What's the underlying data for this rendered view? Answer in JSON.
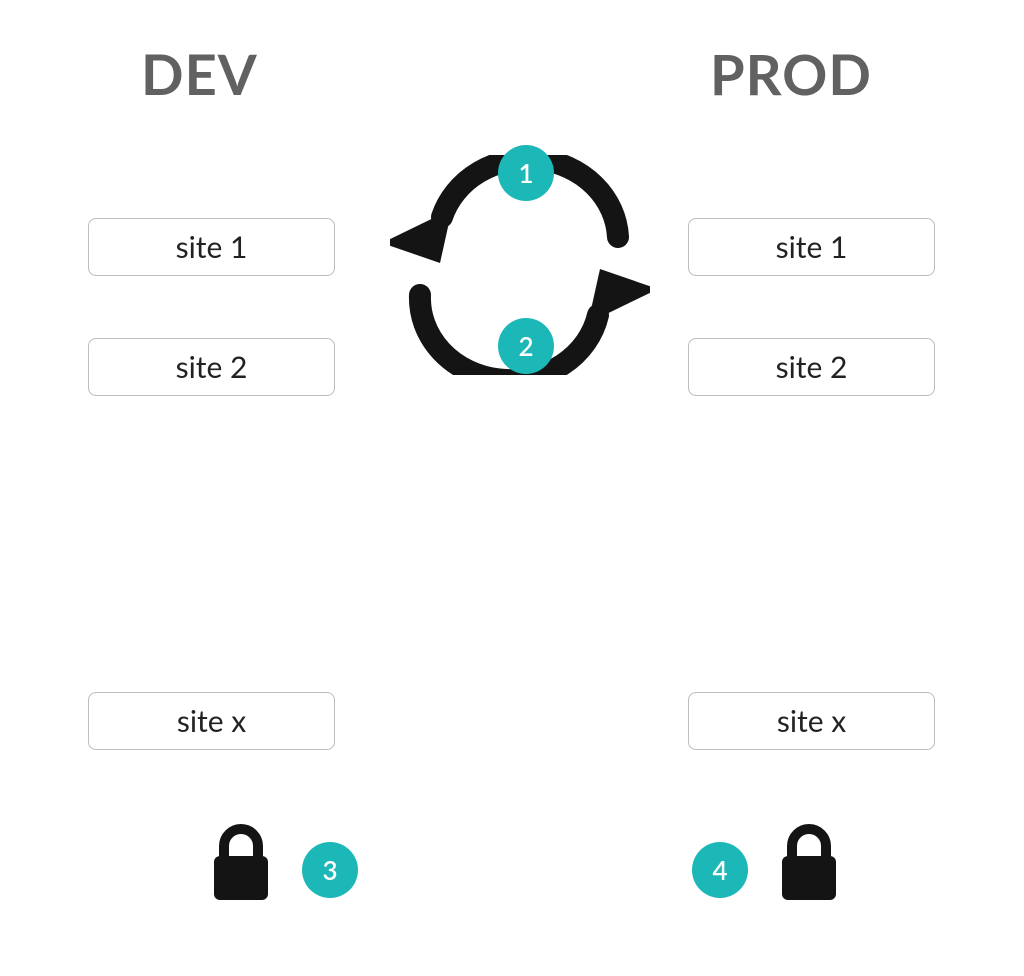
{
  "headings": {
    "dev": "DEV",
    "prod": "PROD"
  },
  "dev_sites": {
    "s1": "site 1",
    "s2": "site 2",
    "sx": "site x"
  },
  "prod_sites": {
    "s1": "site 1",
    "s2": "site 2",
    "sx": "site x"
  },
  "badges": {
    "b1": "1",
    "b2": "2",
    "b3": "3",
    "b4": "4"
  },
  "colors": {
    "accent": "#1cb7b7",
    "heading": "#616161",
    "border": "#bdbdbd",
    "icon": "#141414"
  }
}
